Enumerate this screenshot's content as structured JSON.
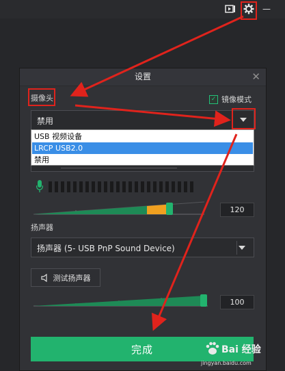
{
  "toolbar": {
    "buttons": [
      {
        "name": "record-screen-icon",
        "interactive": true
      },
      {
        "name": "gear-icon",
        "interactive": true
      },
      {
        "name": "minimize-icon",
        "interactive": true
      }
    ],
    "minimize_label": "—"
  },
  "dialog": {
    "title": "设置",
    "close_symbol": "✕",
    "camera": {
      "label": "摄像头",
      "mirror_label": "镜像模式",
      "mirror_checked": true,
      "selected": "禁用",
      "options": [
        {
          "label": "USB 视频设备",
          "selected": false
        },
        {
          "label": "LRCP  USB2.0",
          "selected": true
        },
        {
          "label": "禁用",
          "selected": false
        }
      ]
    },
    "microphone": {
      "meter_segments": 24,
      "volume": "120"
    },
    "speaker": {
      "label": "扬声器",
      "selected": "扬声器 (5- USB PnP Sound Device)",
      "test_button": "测试扬声器",
      "volume": "100"
    },
    "done_button": "完成"
  },
  "watermark": {
    "brand": "Bai 经验",
    "url": "jingyan.baidu.com"
  },
  "colors": {
    "accent_green": "#22b36e",
    "annotation_red": "#e0231c",
    "selection_blue": "#3a8ee6",
    "mic_level_orange": "#f0a020"
  }
}
